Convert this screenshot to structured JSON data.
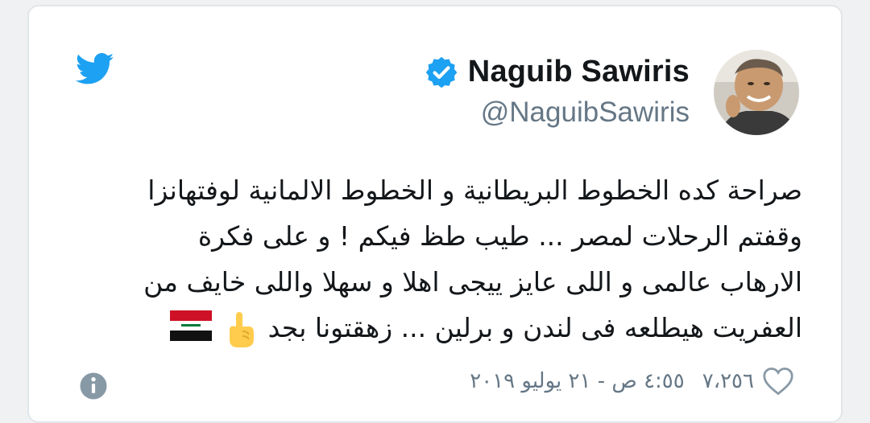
{
  "user": {
    "display_name": "Naguib Sawiris",
    "handle": "@NaguibSawiris",
    "verified": true
  },
  "tweet": {
    "lines": [
      "صراحة كده الخطوط البريطانية و الخطوط الالمانية لوفتهانزا",
      "وقفتم الرحلات لمصر ... طيب طظ فيكم ! و على فكرة",
      "الارهاب عالمى و اللى عايز ييجى اهلا و سهلا  واللى خايف من",
      "العفريت هيطلعه فى لندن و برلين ... زهقتونا بجد"
    ],
    "emojis": [
      "pointing-finger",
      "iraq-flag"
    ]
  },
  "footer": {
    "likes": "٧،٢٥٦",
    "timestamp": "٤:٥٥ ص - ٢١ يوليو ٢٠١٩"
  },
  "icons": {
    "twitter": "twitter-bird-icon",
    "verified": "verified-badge-icon",
    "heart": "heart-icon",
    "info": "info-icon"
  },
  "colors": {
    "twitter_blue": "#1da1f2",
    "text_primary": "#14171a",
    "text_secondary": "#657786"
  }
}
